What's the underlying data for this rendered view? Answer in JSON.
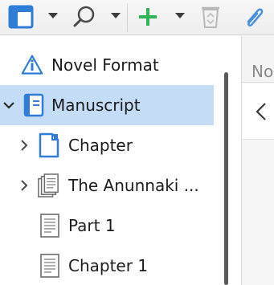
{
  "toolbar": {
    "layout_icon": "layout-panel-icon",
    "search_icon": "search-icon",
    "add_icon": "add-plus-icon",
    "trash_icon": "trash-recycle-icon",
    "attach_icon": "paperclip-icon"
  },
  "binder": {
    "items": [
      {
        "label": "Novel Format",
        "icon": "info-triangle-icon"
      },
      {
        "label": "Manuscript",
        "icon": "manuscript-book-icon",
        "expanded": true,
        "selected": true
      },
      {
        "label": "Chapter",
        "icon": "folder-doc-icon",
        "expanded": false
      },
      {
        "label": "The Anunnaki ...",
        "icon": "stack-docs-icon",
        "expanded": false
      },
      {
        "label": "Part 1",
        "icon": "text-doc-icon"
      },
      {
        "label": "Chapter 1",
        "icon": "text-doc-icon"
      }
    ]
  },
  "editor": {
    "header_label": "No",
    "back_icon": "chevron-left-icon"
  },
  "colors": {
    "selection": "#c4dcf6",
    "accent_blue": "#2f7dd6",
    "add_green": "#2fb457",
    "icon_gray": "#555555"
  }
}
